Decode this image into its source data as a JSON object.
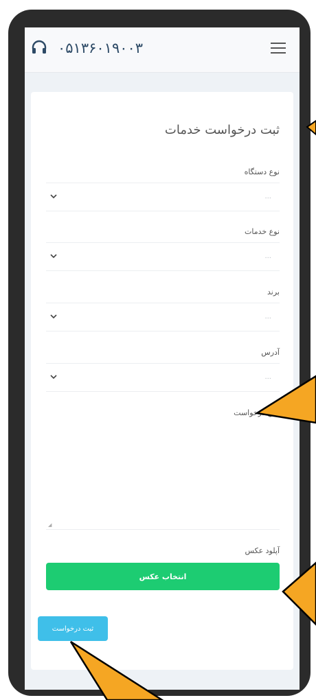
{
  "header": {
    "phone_number": "۰۵۱۳۶۰۱۹۰۰۳",
    "support_icon": "headset-icon",
    "menu_icon": "hamburger-menu-icon"
  },
  "form": {
    "title": "ثبت درخواست خدمات",
    "fields": [
      {
        "label": "نوع دستگاه",
        "placeholder": "..."
      },
      {
        "label": "نوع خدمات",
        "placeholder": "..."
      },
      {
        "label": "برند",
        "placeholder": "..."
      },
      {
        "label": "آدرس",
        "placeholder": "..."
      }
    ],
    "request_text_label": "متن درخواست",
    "upload_label": "آپلود عکس",
    "upload_button": "انتخاب عکس",
    "submit_button": "ثبت درخواست"
  },
  "colors": {
    "upload_green": "#1dcc72",
    "submit_blue": "#3fbfe9",
    "annotation_orange": "#f5a623"
  }
}
